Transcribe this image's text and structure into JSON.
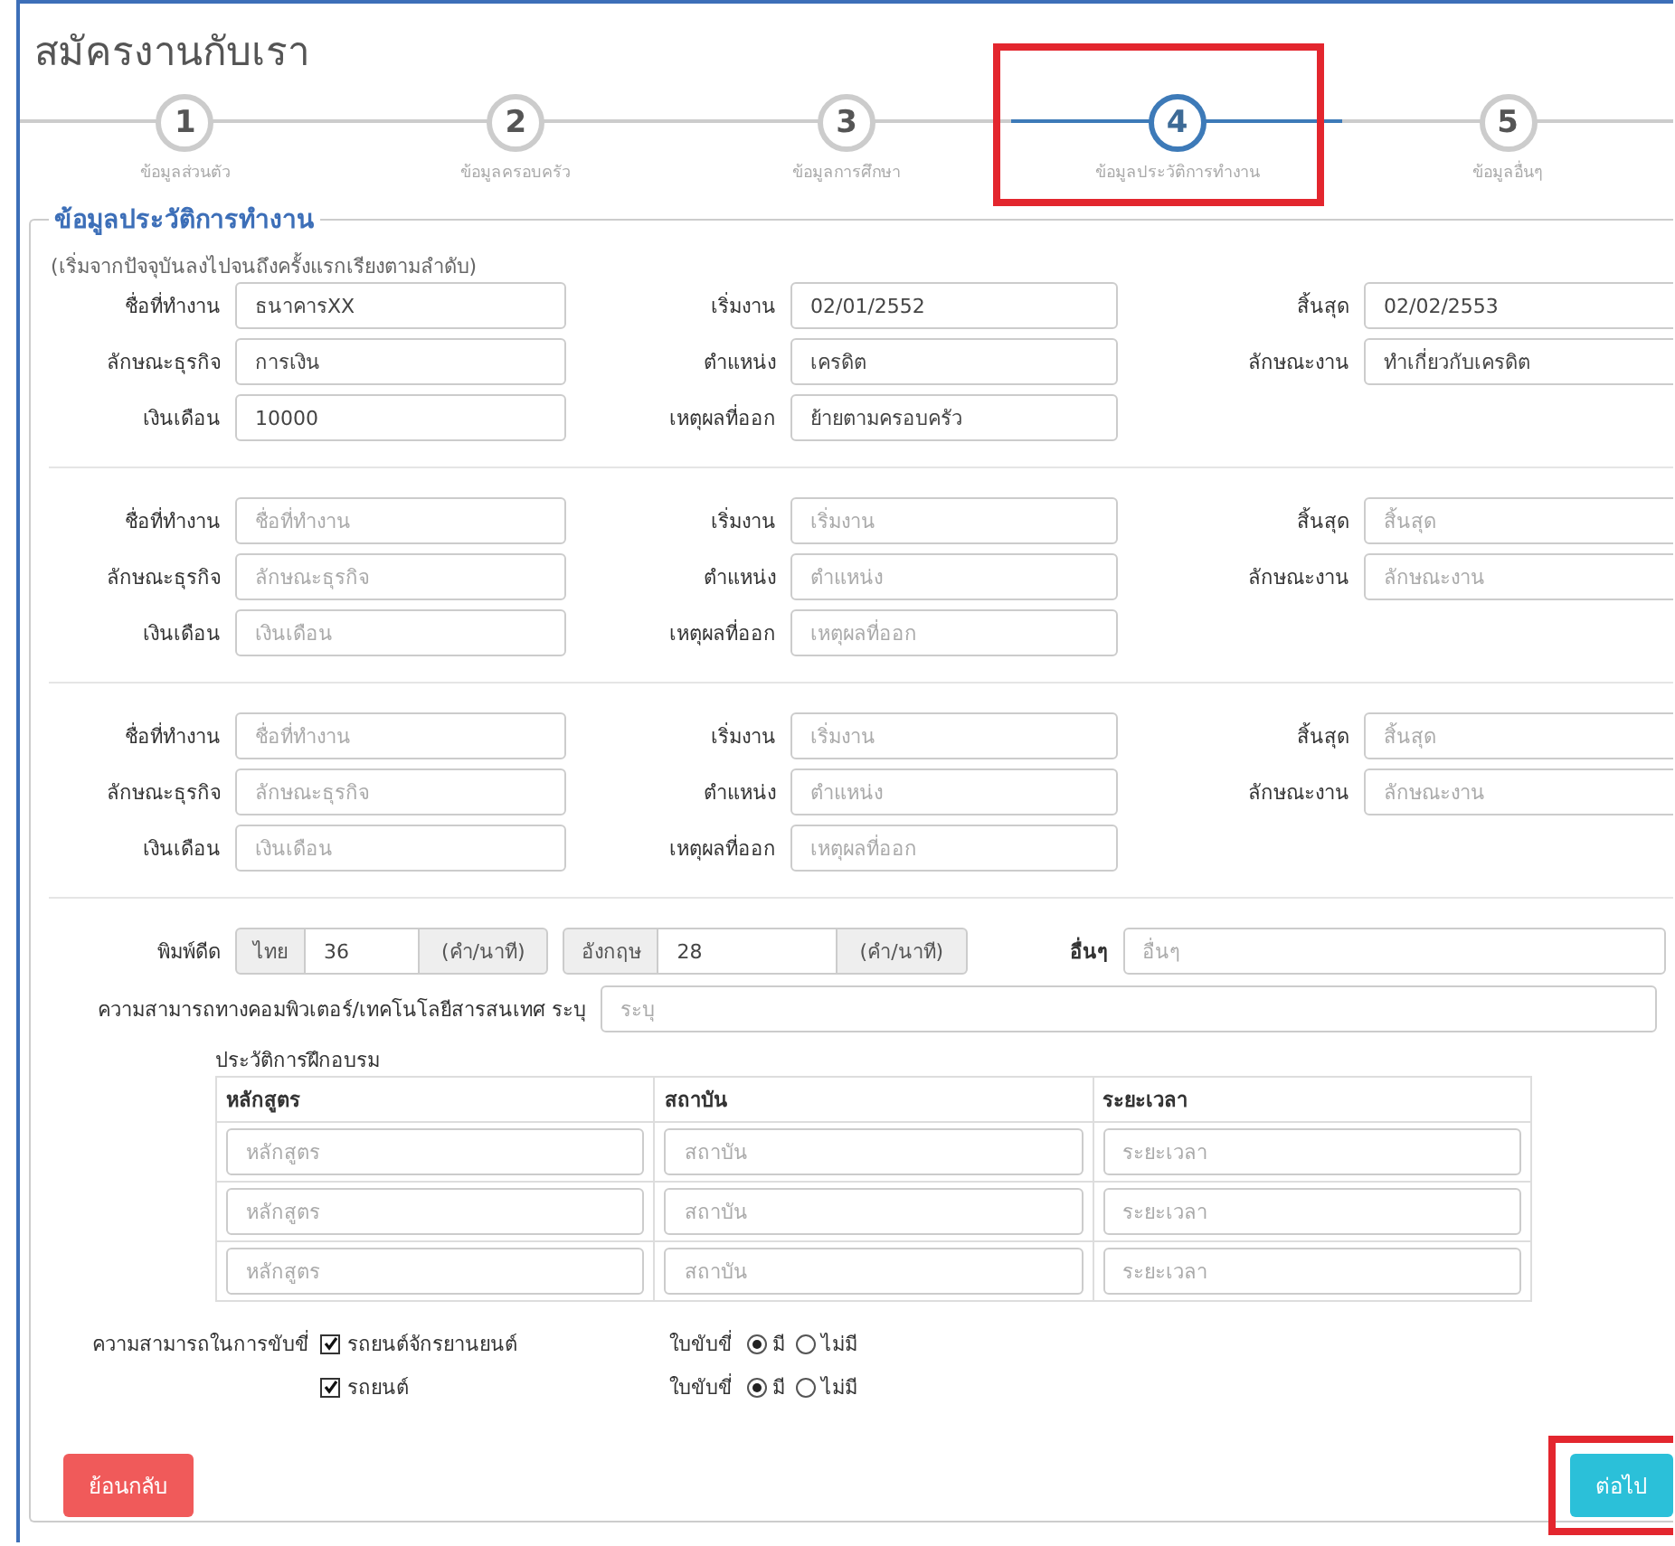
{
  "title": "สมัครงานกับเรา",
  "steps": [
    {
      "number": "1",
      "label": "ข้อมูลส่วนตัว",
      "selected": false,
      "highlighted": false
    },
    {
      "number": "2",
      "label": "ข้อมูลครอบครัว",
      "selected": false,
      "highlighted": false
    },
    {
      "number": "3",
      "label": "ข้อมูลการศึกษา",
      "selected": false,
      "highlighted": false
    },
    {
      "number": "4",
      "label": "ข้อมูลประวัติการทำงาน",
      "selected": true,
      "highlighted": true
    },
    {
      "number": "5",
      "label": "ข้อมูลอื่นๆ",
      "selected": false,
      "highlighted": false
    }
  ],
  "section": {
    "legend": "ข้อมูลประวัติการทำงาน",
    "note": "(เริ่มจากปัจจุบันลงไปจนถึงครั้งแรกเรียงตามลำดับ)"
  },
  "jobs": [
    {
      "fields": [
        {
          "label": "ชื่อที่ทำงาน",
          "value": "ธนาคารXX"
        },
        {
          "label": "เริ่มงาน",
          "value": "02/01/2552"
        },
        {
          "label": "สิ้นสุด",
          "value": "02/02/2553"
        },
        {
          "label": "ลักษณะธุรกิจ",
          "value": "การเงิน"
        },
        {
          "label": "ตำแหน่ง",
          "value": "เครดิต"
        },
        {
          "label": "ลักษณะงาน",
          "value": "ทำเกี่ยวกับเครดิต"
        },
        {
          "label": "เงินเดือน",
          "value": "10000"
        },
        {
          "label": "เหตุผลที่ออก",
          "value": "ย้ายตามครอบครัว"
        }
      ]
    },
    {
      "fields": [
        {
          "label": "ชื่อที่ทำงาน",
          "placeholder": "ชื่อที่ทำงาน"
        },
        {
          "label": "เริ่มงาน",
          "placeholder": "เริ่มงาน"
        },
        {
          "label": "สิ้นสุด",
          "placeholder": "สิ้นสุด"
        },
        {
          "label": "ลักษณะธุรกิจ",
          "placeholder": "ลักษณะธุรกิจ"
        },
        {
          "label": "ตำแหน่ง",
          "placeholder": "ตำแหน่ง"
        },
        {
          "label": "ลักษณะงาน",
          "placeholder": "ลักษณะงาน"
        },
        {
          "label": "เงินเดือน",
          "placeholder": "เงินเดือน"
        },
        {
          "label": "เหตุผลที่ออก",
          "placeholder": "เหตุผลที่ออก"
        }
      ]
    },
    {
      "fields": [
        {
          "label": "ชื่อที่ทำงาน",
          "placeholder": "ชื่อที่ทำงาน"
        },
        {
          "label": "เริ่มงาน",
          "placeholder": "เริ่มงาน"
        },
        {
          "label": "สิ้นสุด",
          "placeholder": "สิ้นสุด"
        },
        {
          "label": "ลักษณะธุรกิจ",
          "placeholder": "ลักษณะธุรกิจ"
        },
        {
          "label": "ตำแหน่ง",
          "placeholder": "ตำแหน่ง"
        },
        {
          "label": "ลักษณะงาน",
          "placeholder": "ลักษณะงาน"
        },
        {
          "label": "เงินเดือน",
          "placeholder": "เงินเดือน"
        },
        {
          "label": "เหตุผลที่ออก",
          "placeholder": "เหตุผลที่ออก"
        }
      ]
    }
  ],
  "typing": {
    "label": "พิมพ์ดีด",
    "groups": [
      {
        "prefix": "ไทย",
        "value": "36",
        "suffix": "(คำ/นาที)"
      },
      {
        "prefix": "อังกฤษ",
        "value": "28",
        "suffix": "(คำ/นาที)"
      }
    ],
    "other_label": "อื่นๆ",
    "other_placeholder": "อื่นๆ"
  },
  "computer": {
    "label": "ความสามารถทางคอมพิวเตอร์/เทคโนโลยีสารสนเทศ ระบุ",
    "placeholder": "ระบุ"
  },
  "training": {
    "title": "ประวัติการฝึกอบรม",
    "columns": [
      "หลักสูตร",
      "สถาบัน",
      "ระยะเวลา"
    ],
    "rows": [
      {
        "cells": [
          {
            "placeholder": "หลักสูตร"
          },
          {
            "placeholder": "สถาบัน"
          },
          {
            "placeholder": "ระยะเวลา"
          }
        ]
      },
      {
        "cells": [
          {
            "placeholder": "หลักสูตร"
          },
          {
            "placeholder": "สถาบัน"
          },
          {
            "placeholder": "ระยะเวลา"
          }
        ]
      },
      {
        "cells": [
          {
            "placeholder": "หลักสูตร"
          },
          {
            "placeholder": "สถาบัน"
          },
          {
            "placeholder": "ระยะเวลา"
          }
        ]
      }
    ]
  },
  "driving": {
    "label": "ความสามารถในการขับขี่",
    "items": [
      {
        "vehicle": "รถยนต์จักรยานยนต์",
        "checked": true,
        "license_label": "ใบขับขี่",
        "options": [
          {
            "label": "มี",
            "selected": true
          },
          {
            "label": "ไม่มี",
            "selected": false
          }
        ]
      },
      {
        "vehicle": "รถยนต์",
        "checked": true,
        "license_label": "ใบขับขี่",
        "options": [
          {
            "label": "มี",
            "selected": true
          },
          {
            "label": "ไม่มี",
            "selected": false
          }
        ]
      }
    ]
  },
  "buttons": [
    {
      "label": "ย้อนกลับ",
      "kind": "back",
      "highlighted": false
    },
    {
      "label": "ต่อไป",
      "kind": "next",
      "highlighted": true
    }
  ]
}
